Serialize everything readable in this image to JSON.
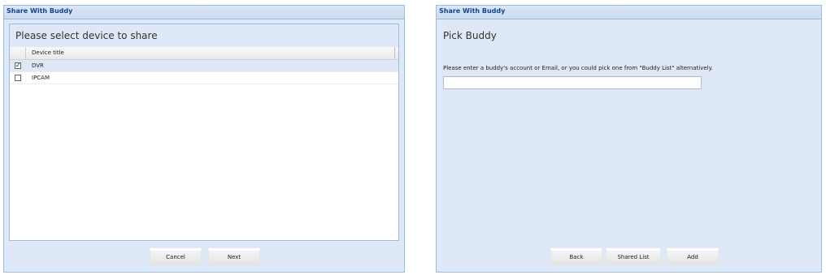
{
  "select_dialog": {
    "title": "Share With Buddy",
    "heading": "Please select device to share",
    "columns": [
      "Device title"
    ],
    "rows": [
      {
        "label": "DVR",
        "checked": true
      },
      {
        "label": "IPCAM",
        "checked": false
      }
    ],
    "cancel_label": "Cancel",
    "next_label": "Next"
  },
  "pick_dialog": {
    "title": "Share With Buddy",
    "heading": "Pick Buddy",
    "instructions": "Please enter a buddy's account or Email, or you could pick one from \"Buddy List\" alternatively.",
    "input_value": "",
    "input_placeholder": "",
    "back_label": "Back",
    "shared_list_label": "Shared List",
    "add_label": "Add"
  },
  "icons": {
    "checkbox_checked": "check-icon"
  },
  "colors": {
    "title_text": "#15428b",
    "dialog_bg": "#dfe8f6",
    "border": "#99bbe8"
  }
}
